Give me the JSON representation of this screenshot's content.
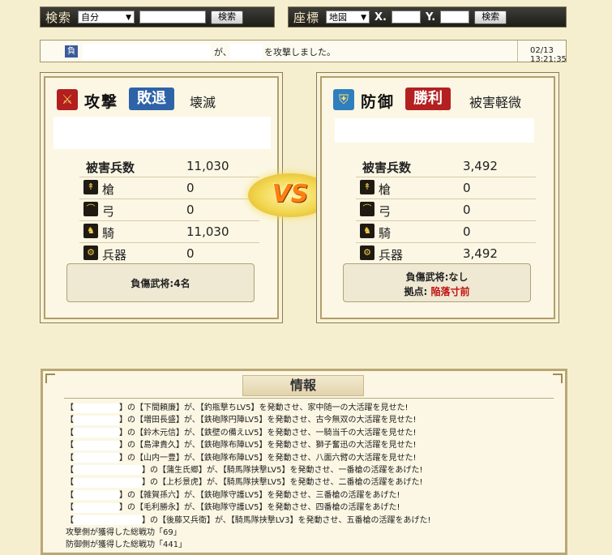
{
  "search_bar": {
    "label": "検索",
    "select_value": "自分",
    "input_value": "",
    "button_label": "検索"
  },
  "coord_bar": {
    "label": "座標",
    "select_value": "地図",
    "x_label": "X.",
    "y_label": "Y.",
    "x_value": "",
    "y_value": "",
    "button_label": "検索"
  },
  "notice": {
    "badge": "負",
    "text_ga": "が、",
    "text_suffix": "を攻撃しました。",
    "timestamp": "02/13 13:21:35"
  },
  "vs_label": "VS",
  "attack": {
    "side_label": "攻撃",
    "result": "敗退",
    "status": "壊滅",
    "damage_label": "被害兵数",
    "damage_value": "11,030",
    "units": [
      {
        "name": "槍",
        "value": "0",
        "icon": "spear-icon"
      },
      {
        "name": "弓",
        "value": "0",
        "icon": "bow-icon"
      },
      {
        "name": "騎",
        "value": "11,030",
        "icon": "horse-icon"
      },
      {
        "name": "兵器",
        "value": "0",
        "icon": "siege-icon"
      }
    ],
    "wounded_label": "負傷武将:",
    "wounded_value": "4名"
  },
  "defense": {
    "side_label": "防御",
    "result": "勝利",
    "status": "被害軽微",
    "damage_label": "被害兵数",
    "damage_value": "3,492",
    "units": [
      {
        "name": "槍",
        "value": "0",
        "icon": "spear-icon"
      },
      {
        "name": "弓",
        "value": "0",
        "icon": "bow-icon"
      },
      {
        "name": "騎",
        "value": "0",
        "icon": "horse-icon"
      },
      {
        "name": "兵器",
        "value": "3,492",
        "icon": "siege-icon"
      }
    ],
    "wounded_label": "負傷武将:",
    "wounded_value": "なし",
    "base_label": "拠点:",
    "base_value": "陥落寸前"
  },
  "info": {
    "title": "情報",
    "lines": [
      "】の【下間頼廉】が、【釣瓶撃ちLV5】を発動させ、家中随一の大活躍を見せた!",
      "】の【増田長盛】が、【鉄砲隊円陣LV5】を発動させ、古今無双の大活躍を見せた!",
      "】の【鈴木元信】が、【鉄壁の備えLV5】を発動させ、一騎当千の大活躍を見せた!",
      "】の【島津貴久】が、【鉄砲隊布陣LV5】を発動させ、獅子奮迅の大活躍を見せた!",
      "】の【山内一豊】が、【鉄砲隊布陣LV5】を発動させ、八面六臂の大活躍を見せた!",
      "】の【蒲生氏郷】が、【騎馬隊挟撃LV5】を発動させ、一番槍の活躍をあげた!",
      "】の【上杉景虎】が、【騎馬隊挟撃LV5】を発動させ、二番槍の活躍をあげた!",
      "】の【雑賀孫六】が、【鉄砲隊守護LV5】を発動させ、三番槍の活躍をあげた!",
      "】の【毛利勝永】が、【鉄砲隊守護LV5】を発動させ、四番槍の活躍をあげた!",
      "】の【後藤又兵衛】が、【騎馬隊挟撃LV3】を発動させ、五番槍の活躍をあげた!"
    ],
    "line_prefixes": [
      "【",
      "【",
      "【",
      "【",
      "【",
      "【",
      "【",
      "【",
      "【",
      "【"
    ],
    "attack_merit_label": "攻撃側が獲得した総戦功「69」",
    "defense_merit_label": "防御側が獲得した総戦功「441」"
  },
  "colors": {
    "background": "#f6efcf",
    "lose_tag": "#2f63a8",
    "win_tag": "#b42020",
    "base_danger": "#c01010"
  }
}
